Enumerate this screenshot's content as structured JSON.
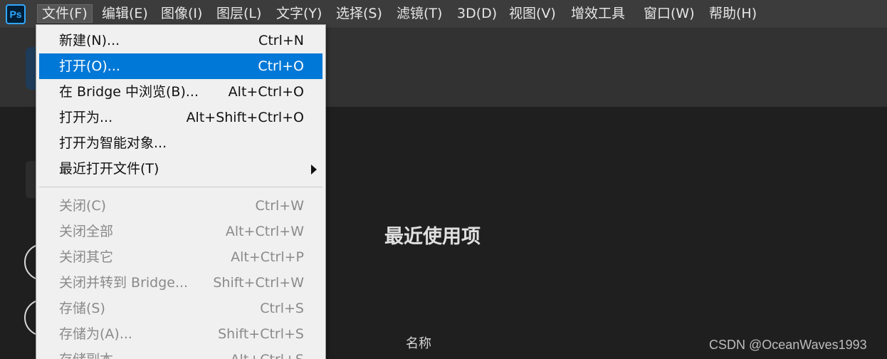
{
  "app": {
    "logo_text": "Ps"
  },
  "menubar": {
    "items": [
      {
        "label": "文件(F)"
      },
      {
        "label": "编辑(E)"
      },
      {
        "label": "图像(I)"
      },
      {
        "label": "图层(L)"
      },
      {
        "label": "文字(Y)"
      },
      {
        "label": "选择(S)"
      },
      {
        "label": "滤镜(T)"
      },
      {
        "label": "3D(D)"
      },
      {
        "label": "视图(V)"
      },
      {
        "label": "增效工具"
      },
      {
        "label": "窗口(W)"
      },
      {
        "label": "帮助(H)"
      }
    ],
    "active_index": 0
  },
  "file_menu": {
    "items": [
      {
        "label": "新建(N)...",
        "shortcut": "Ctrl+N",
        "state": "normal"
      },
      {
        "label": "打开(O)...",
        "shortcut": "Ctrl+O",
        "state": "highlighted"
      },
      {
        "label": "在 Bridge 中浏览(B)...",
        "shortcut": "Alt+Ctrl+O",
        "state": "normal"
      },
      {
        "label": "打开为...",
        "shortcut": "Alt+Shift+Ctrl+O",
        "state": "normal"
      },
      {
        "label": "打开为智能对象...",
        "shortcut": "",
        "state": "normal"
      },
      {
        "label": "最近打开文件(T)",
        "shortcut": "",
        "state": "normal",
        "submenu": true
      },
      {
        "label": "关闭(C)",
        "shortcut": "Ctrl+W",
        "state": "disabled"
      },
      {
        "label": "关闭全部",
        "shortcut": "Alt+Ctrl+W",
        "state": "disabled"
      },
      {
        "label": "关闭其它",
        "shortcut": "Alt+Ctrl+P",
        "state": "disabled"
      },
      {
        "label": "关闭并转到 Bridge...",
        "shortcut": "Shift+Ctrl+W",
        "state": "disabled"
      },
      {
        "label": "存储(S)",
        "shortcut": "Ctrl+S",
        "state": "disabled"
      },
      {
        "label": "存储为(A)...",
        "shortcut": "Shift+Ctrl+S",
        "state": "disabled"
      },
      {
        "label": "存储副本...",
        "shortcut": "Alt+Ctrl+S",
        "state": "disabled"
      }
    ]
  },
  "home": {
    "recent_title": "最近使用项",
    "column_name": "名称"
  },
  "watermark": "CSDN @OceanWaves1993",
  "colors": {
    "menubar_bg": "#3c3c3c",
    "menu_highlight": "#0078d7",
    "background": "#1f1f1f",
    "ps_blue": "#31a8ff"
  },
  "icons": {
    "logo": "photoshop-logo",
    "submenu": "triangle-right-icon"
  }
}
